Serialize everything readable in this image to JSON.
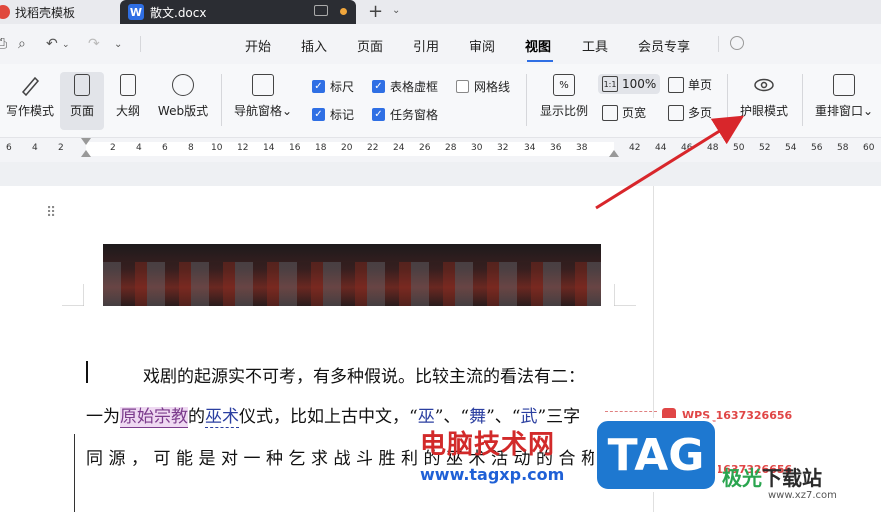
{
  "tabs": [
    {
      "label": "找稻壳模板"
    },
    {
      "label": "散文.docx",
      "icon_letter": "W"
    }
  ],
  "menu": {
    "items": [
      "开始",
      "插入",
      "页面",
      "引用",
      "审阅",
      "视图",
      "工具",
      "会员专享"
    ],
    "active": "视图"
  },
  "ribbon": {
    "view_modes": [
      "写作模式",
      "页面",
      "大纲",
      "Web版式"
    ],
    "nav_pane": "导航窗格",
    "checkboxes": [
      {
        "label": "标尺",
        "checked": true
      },
      {
        "label": "表格虚框",
        "checked": true
      },
      {
        "label": "网格线",
        "checked": false
      },
      {
        "label": "标记",
        "checked": true
      },
      {
        "label": "任务窗格",
        "checked": true
      }
    ],
    "zoom_ratio": "显示比例",
    "zoom_100": "100%",
    "zoom_100_icon": "1:1",
    "page_width": "页宽",
    "single_page": "单页",
    "multi_page": "多页",
    "eye_mode": "护眼模式",
    "rearrange": "重排窗口"
  },
  "ruler": {
    "ticks": [
      "6",
      "4",
      "2",
      "2",
      "4",
      "6",
      "8",
      "10",
      "12",
      "14",
      "16",
      "18",
      "20",
      "22",
      "24",
      "26",
      "28",
      "30",
      "32",
      "34",
      "36",
      "38",
      "42",
      "44",
      "46",
      "48",
      "50",
      "52",
      "54",
      "56",
      "58",
      "60"
    ]
  },
  "document": {
    "line1": "戏剧的起源实不可考，有多种假说。比较主流的看法有二：",
    "line2_pre": "一为",
    "line2_hl1": "原始宗教",
    "line2_mid1": "的",
    "line2_hl2": "巫术",
    "line2_mid2": "仪式，比如上古中文，“",
    "line2_q1": "巫",
    "line2_sep1": "”、“",
    "line2_q2": "舞",
    "line2_sep2": "”、“",
    "line2_q3": "武",
    "line2_post": "”三字",
    "line3": "同源，可能是对一种乞求战斗胜利的巫术活动的合称"
  },
  "comments": [
    {
      "author": "WPS_1637326656"
    },
    {
      "author": "WPS_1637326656"
    }
  ],
  "watermarks": {
    "main": "电脑技术网",
    "url": "www.tagxp.com",
    "tag": "TAG",
    "xz_part1": "极光",
    "xz_part2": "下载站",
    "xz_url": "www.xz7.com"
  }
}
